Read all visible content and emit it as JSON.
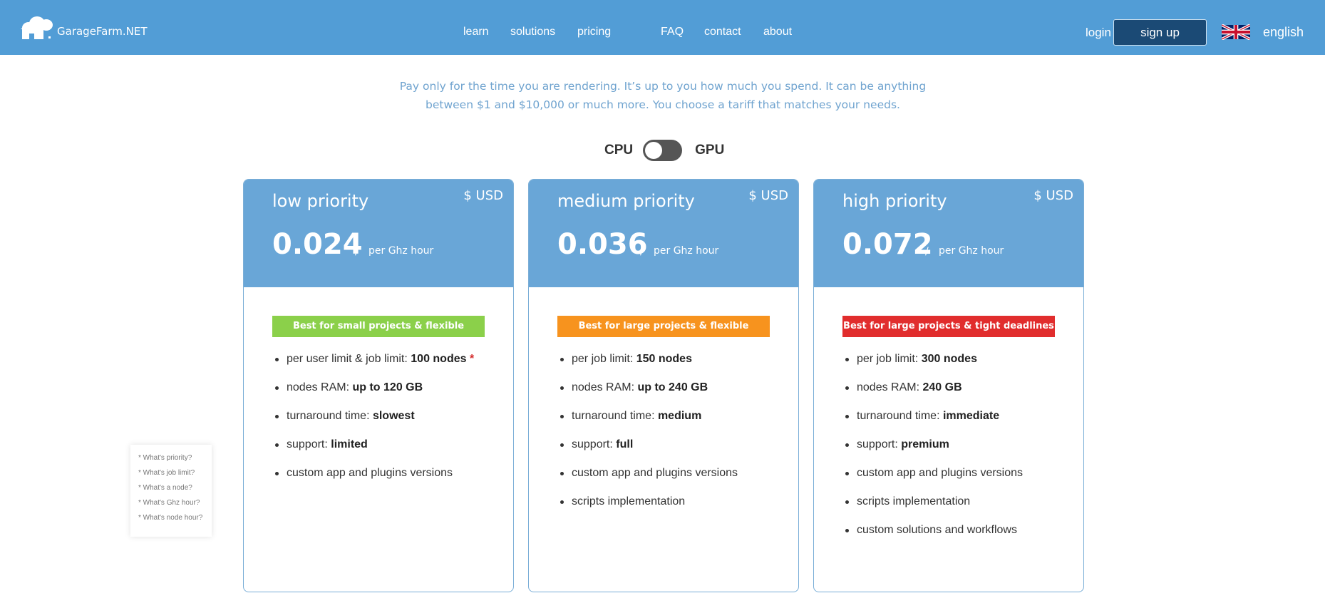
{
  "header": {
    "logo_text": "GarageFarm.NET",
    "nav": [
      "learn",
      "solutions",
      "pricing",
      "FAQ",
      "contact",
      "about"
    ],
    "login": "login",
    "signup": "sign up",
    "language": "english",
    "colors": {
      "bar": "#529dd6",
      "signup": "#1b4a75"
    }
  },
  "intro": {
    "line1": "Pay only for the time you are rendering. It’s up to you how much you spend. It can be anything",
    "line2": "between $1 and $10,000 or much more. You choose a tariff that matches your needs."
  },
  "toggle": {
    "left": "CPU",
    "right": "GPU",
    "selected": "CPU"
  },
  "cards": [
    {
      "title": "low priority",
      "currency": "$ USD",
      "price": "0.024",
      "slash": "/",
      "unit": "per Ghz hour",
      "badge": "Best for small projects & flexible deadlines",
      "badge_color": "#8bd04a",
      "features": [
        {
          "label": "per user limit & job limit: ",
          "value": "100 nodes",
          "note": "*"
        },
        {
          "label": "nodes RAM: ",
          "value": "up to 120 GB"
        },
        {
          "label": "turnaround time: ",
          "value": "slowest"
        },
        {
          "label": "support: ",
          "value": "limited"
        },
        {
          "label": "custom app and plugins versions"
        }
      ]
    },
    {
      "title": "medium priority",
      "currency": "$ USD",
      "price": "0.036",
      "slash": "/",
      "unit": "per Ghz hour",
      "badge": "Best for large projects & flexible deadlines",
      "badge_color": "#f7931e",
      "features": [
        {
          "label": "per job limit: ",
          "value": "150 nodes"
        },
        {
          "label": "nodes RAM: ",
          "value": "up to 240 GB"
        },
        {
          "label": "turnaround time: ",
          "value": "medium"
        },
        {
          "label": "support: ",
          "value": "full"
        },
        {
          "label": "custom app and plugins versions"
        },
        {
          "label": "scripts implementation"
        }
      ]
    },
    {
      "title": "high priority",
      "currency": "$ USD",
      "price": "0.072",
      "slash": "/",
      "unit": "per Ghz hour",
      "badge": "Best for large projects & tight deadlines",
      "badge_color": "#e12d2d",
      "features": [
        {
          "label": "per job limit: ",
          "value": "300 nodes"
        },
        {
          "label": "nodes RAM: ",
          "value": "240 GB"
        },
        {
          "label": "turnaround time: ",
          "value": "immediate"
        },
        {
          "label": "support: ",
          "value": "premium"
        },
        {
          "label": "custom app and plugins versions"
        },
        {
          "label": "scripts implementation"
        },
        {
          "label": "custom solutions and workflows"
        }
      ]
    }
  ],
  "faq": [
    "* What's priority?",
    "* What's job limit?",
    "* What's a node?",
    "* What's Ghz hour?",
    "* What's node hour?"
  ]
}
